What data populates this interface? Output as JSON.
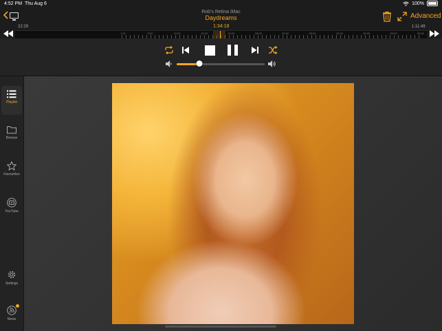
{
  "status": {
    "time": "4:52 PM",
    "date": "Thu Aug 6",
    "battery": "100%"
  },
  "header": {
    "host": "Rob's Retina iMac",
    "track": "Daydreams",
    "advanced_label": "Advanced",
    "accent": "#f5a623"
  },
  "seek": {
    "elapsed": "22:29",
    "current": "1:34:18",
    "remaining": "1:11:49",
    "tick_labels": [
      "1:01",
      "5:00",
      "10:00",
      "15:00",
      "20:00",
      "25:00",
      "30:00",
      "35:00",
      "40:00",
      "45:00",
      "50:00",
      "55:00"
    ]
  },
  "transport": {
    "buttons": [
      "repeat-icon",
      "previous-icon",
      "stop-icon",
      "pause-icon",
      "next-icon",
      "shuffle-icon"
    ],
    "volume": 0.26
  },
  "sidebar": {
    "items": [
      {
        "label": "Playlist",
        "icon": "playlist-icon",
        "active": true
      },
      {
        "label": "Browse",
        "icon": "folder-icon",
        "active": false
      },
      {
        "label": "Favourites",
        "icon": "star-icon",
        "active": false
      },
      {
        "label": "YouTube",
        "icon": "youtube-icon",
        "active": false
      },
      {
        "label": "Settings",
        "icon": "gear-icon",
        "active": false
      },
      {
        "label": "News",
        "icon": "rss-icon",
        "active": false
      }
    ]
  }
}
